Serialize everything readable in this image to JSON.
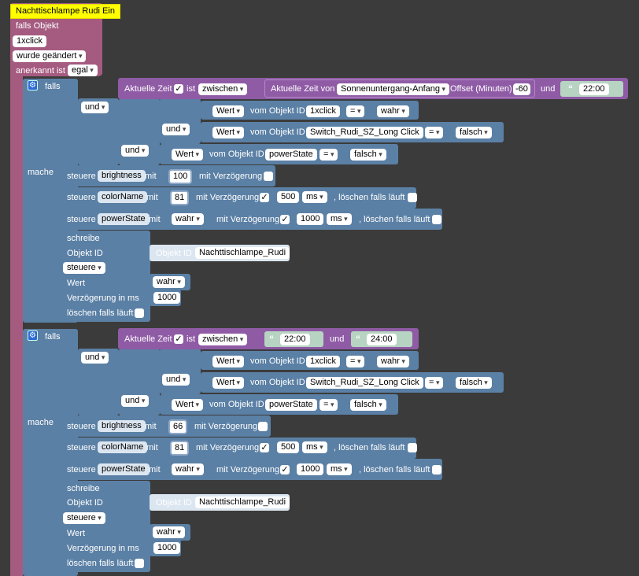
{
  "trigger": {
    "title": "Nachttischlampe Rudi Ein",
    "falls_objekt": "falls Objekt",
    "object_id": "1xclick",
    "wurde_geaendert": "wurde geändert",
    "anerkannt_ist": "anerkannt ist",
    "anerkannt_value": "egal"
  },
  "labels": {
    "falls": "falls",
    "mache": "mache",
    "und": "und",
    "aktuelle_zeit": "Aktuelle Zeit",
    "ist": "ist",
    "zwischen": "zwischen",
    "aktuelle_zeit_von": "Aktuelle Zeit von",
    "sunset": "Sonnenuntergang-Anfang",
    "offset": "Offset (Minuten)",
    "offset_value": "-60",
    "und_small": "und",
    "wert": "Wert",
    "vom_objekt_id": "vom Objekt ID",
    "eq": "=",
    "steuere": "steuere",
    "mit": "mit",
    "mit_verzoegerung": "mit Verzögerung",
    "ms": "ms",
    "loeschen": ", löschen falls läuft",
    "schreibe": "schreibe",
    "objekt_id": "Objekt ID",
    "wert_label": "Wert",
    "verzoegerung_in_ms": "Verzögerung in ms",
    "loeschen_falls": "löschen falls läuft"
  },
  "branch1": {
    "time_start": "22:00",
    "c1_obj": "1xclick",
    "c1_val": "wahr",
    "c2_obj": "Switch_Rudi_SZ_Long Click",
    "c2_val": "falsch",
    "c3_obj": "powerState",
    "c3_val": "falsch",
    "s1_attr": "brightness",
    "s1_val": "100",
    "s2_attr": "colorName",
    "s2_val": "81",
    "s2_delay": "500",
    "s3_attr": "powerState",
    "s3_val": "wahr",
    "s3_delay": "1000",
    "obj_label": "Objekt ID",
    "obj_id": "Nachttischlampe_Rudi",
    "write_mode": "steuere",
    "write_val": "wahr",
    "write_delay": "1000"
  },
  "branch2": {
    "time_start": "22:00",
    "time_end": "24:00",
    "c1_obj": "1xclick",
    "c1_val": "wahr",
    "c2_obj": "Switch_Rudi_SZ_Long Click",
    "c2_val": "falsch",
    "c3_obj": "powerState",
    "c3_val": "falsch",
    "s1_attr": "brightness",
    "s1_val": "66",
    "s2_attr": "colorName",
    "s2_val": "81",
    "s2_delay": "500",
    "s3_attr": "powerState",
    "s3_val": "wahr",
    "s3_delay": "1000",
    "obj_label": "Objekt ID",
    "obj_id": "Nachttischlampe_Rudi",
    "write_mode": "steuere",
    "write_val": "wahr",
    "write_delay": "1000"
  },
  "colors": {
    "trigger": "#a55b80",
    "logic": "#5b80a5",
    "time": "#8f5ba5",
    "title_bg": "#ffff00"
  }
}
